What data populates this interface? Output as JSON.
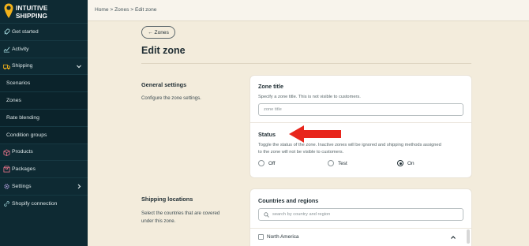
{
  "app": {
    "logo_line1": "INTUITIVE",
    "logo_line2": "SHIPPING"
  },
  "colors": {
    "sidebar_bg": "#0e2a33",
    "page_bg": "#f3ecdc",
    "logo_accent": "#f2b21b",
    "annotation_arrow": "#e8261c"
  },
  "sidebar": {
    "items": [
      {
        "label": "Get started",
        "icon": "rocket-icon"
      },
      {
        "label": "Activity",
        "icon": "activity-icon"
      },
      {
        "label": "Shipping",
        "icon": "truck-icon",
        "expanded": true
      },
      {
        "label": "Scenarios",
        "sub": true
      },
      {
        "label": "Zones",
        "sub": true
      },
      {
        "label": "Rate blending",
        "sub": true
      },
      {
        "label": "Condition groups",
        "sub": true
      },
      {
        "label": "Products",
        "icon": "box-icon"
      },
      {
        "label": "Packages",
        "icon": "package-icon"
      },
      {
        "label": "Settings",
        "icon": "gear-icon",
        "has_children": true
      },
      {
        "label": "Shopify connection",
        "icon": "link-icon"
      }
    ]
  },
  "breadcrumb": "Home > Zones > Edit zone",
  "page": {
    "back_label": "← Zones",
    "title": "Edit zone"
  },
  "general": {
    "title": "General settings",
    "desc": "Configure the zone settings.",
    "zone_title": {
      "heading": "Zone title",
      "help": "Specify a zone title. This is not visible to customers.",
      "placeholder": "zone title",
      "value": ""
    },
    "status": {
      "heading": "Status",
      "help_line1": "Toggle the status of the zone. Inactive zones will be ignored and shipping methods assigned",
      "help_line2": "to the zone will not be visible to customers.",
      "options": [
        "Off",
        "Test",
        "On"
      ],
      "selected": "On"
    }
  },
  "locations": {
    "title": "Shipping locations",
    "desc_line1": "Select the countries that are covered",
    "desc_line2": "under this zone.",
    "card_heading": "Countries and regions",
    "search_placeholder": "search by country and region",
    "regions": [
      {
        "label": "North America",
        "checked": false
      }
    ]
  }
}
